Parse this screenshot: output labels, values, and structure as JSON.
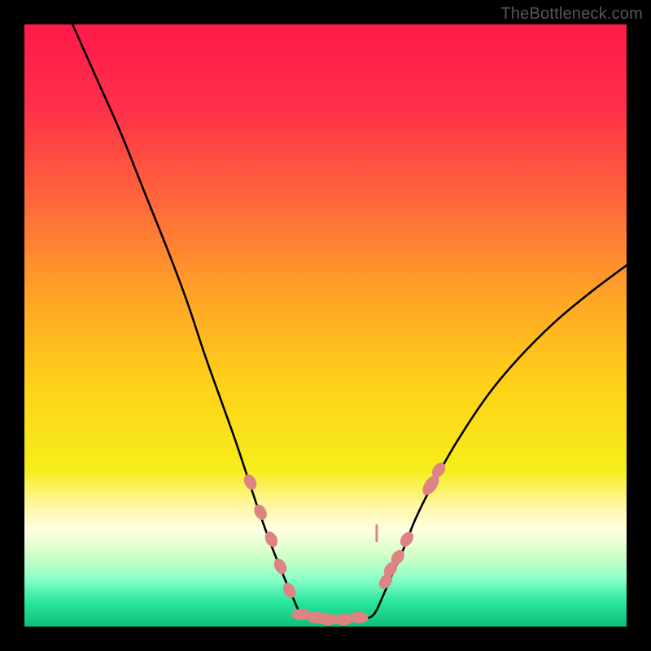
{
  "watermark": "TheBottleneck.com",
  "colors": {
    "gradient_stops": [
      {
        "offset": 0.0,
        "color": "#ff1a4b"
      },
      {
        "offset": 0.14,
        "color": "#ff3049"
      },
      {
        "offset": 0.3,
        "color": "#ff6a3a"
      },
      {
        "offset": 0.46,
        "color": "#ffa726"
      },
      {
        "offset": 0.6,
        "color": "#ffd21a"
      },
      {
        "offset": 0.74,
        "color": "#f6ee1a"
      },
      {
        "offset": 0.8,
        "color": "#fff7a6"
      },
      {
        "offset": 0.84,
        "color": "#ffffe2"
      },
      {
        "offset": 0.88,
        "color": "#d4ffc9"
      },
      {
        "offset": 0.92,
        "color": "#8cffc9"
      },
      {
        "offset": 0.96,
        "color": "#28e69e"
      },
      {
        "offset": 1.0,
        "color": "#0fbf7a"
      }
    ],
    "curve": "#000000",
    "markers": "#dd8482",
    "frame": "#000000"
  },
  "chart_data": {
    "type": "line",
    "title": "",
    "xlabel": "",
    "ylabel": "",
    "xlim": [
      0,
      100
    ],
    "ylim": [
      0,
      100
    ],
    "series": [
      {
        "name": "left-curve",
        "x": [
          8,
          12,
          16,
          20,
          24,
          27,
          30,
          32.5,
          35,
          37,
          39,
          41,
          43,
          44.5,
          46
        ],
        "y": [
          100,
          91,
          82,
          72,
          62,
          54,
          45,
          38,
          31,
          25,
          19,
          13.5,
          8.5,
          5,
          2
        ]
      },
      {
        "name": "right-curve",
        "x": [
          58,
          59.5,
          61,
          63,
          65,
          68,
          72,
          77,
          82,
          88,
          94,
          100
        ],
        "y": [
          2,
          5,
          8.5,
          13,
          18,
          24,
          31,
          38.5,
          44.5,
          50.5,
          55.5,
          60
        ]
      },
      {
        "name": "bottom-flat",
        "x": [
          46,
          48,
          50,
          52,
          54,
          56,
          58
        ],
        "y": [
          2,
          1.2,
          1,
          1,
          1,
          1.2,
          2
        ]
      }
    ],
    "markers": {
      "left_cluster": {
        "x": [
          37.5,
          39.2,
          41.0,
          42.5,
          44.0
        ],
        "y": [
          24.0,
          19.0,
          14.5,
          10.0,
          6.0
        ]
      },
      "right_cluster": {
        "x": [
          60.0,
          60.8,
          62.0,
          63.5,
          67.5,
          68.8
        ],
        "y": [
          7.5,
          9.5,
          11.5,
          14.5,
          23.5,
          26.0
        ]
      },
      "bottom_row": {
        "x": [
          46.0,
          48.5,
          50.5,
          53.0,
          55.5
        ],
        "y": [
          2.0,
          1.5,
          1.2,
          1.2,
          1.5
        ]
      },
      "mid_right_tick": {
        "x": [
          58.5
        ],
        "y": [
          15.5
        ]
      }
    }
  }
}
